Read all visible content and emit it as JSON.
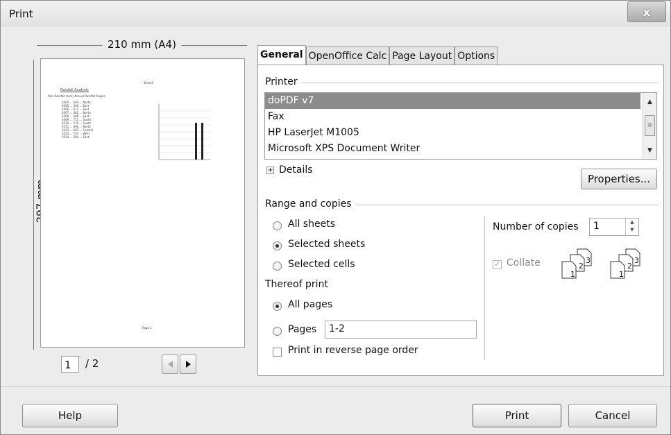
{
  "window": {
    "title": "Print",
    "close_glyph": "x"
  },
  "preview": {
    "width_label": "210 mm (A4)",
    "height_label": "297 mm",
    "current_page": "1",
    "total_pages": "/ 2",
    "mini": {
      "sheet_label": "Sheet1",
      "title": "Rainfall Analysis",
      "header": "Year     Rainfall (mm)   Annual Rainfall Region",
      "rows": [
        "2004 ... 564 ... North",
        "2005 ... 560 ... East",
        "2006 ... 673 ... East",
        "2007 ... 482 ... North",
        "2008 ... 608 ... East",
        "2009 ... 715 ... South",
        "2010 ... 576 ... South",
        "2011 ... 496 ... North",
        "2012 ... 603 ... Central",
        "2013 ... 744 ... West",
        "2014 ... 584 ... East"
      ],
      "footer": "Page 1"
    }
  },
  "tabs": [
    "General",
    "OpenOffice Calc",
    "Page Layout",
    "Options"
  ],
  "printer": {
    "section_label": "Printer",
    "items": [
      "doPDF v7",
      "Fax",
      "HP LaserJet M1005",
      "Microsoft XPS Document Writer"
    ],
    "selected_index": 0,
    "details_label": "Details",
    "properties_label": "Properties..."
  },
  "range": {
    "section_label": "Range and copies",
    "options": [
      "All sheets",
      "Selected sheets",
      "Selected cells"
    ],
    "selected": "Selected sheets",
    "thereof_label": "Thereof print",
    "print_options": [
      "All pages",
      "Pages"
    ],
    "print_selected": "All pages",
    "pages_value": "1-2",
    "reverse_label": "Print in reverse page order",
    "reverse_checked": false
  },
  "copies": {
    "label": "Number of copies",
    "value": "1",
    "collate_label": "Collate",
    "collate_checked": true,
    "collate_enabled": false
  },
  "buttons": {
    "help": "Help",
    "print": "Print",
    "cancel": "Cancel"
  },
  "icons": {
    "scroll_up": "up-arrow-icon",
    "scroll_down": "down-arrow-icon",
    "nav_prev": "triangle-left-icon",
    "nav_next": "triangle-right-icon",
    "expand": "plus-box-icon"
  }
}
